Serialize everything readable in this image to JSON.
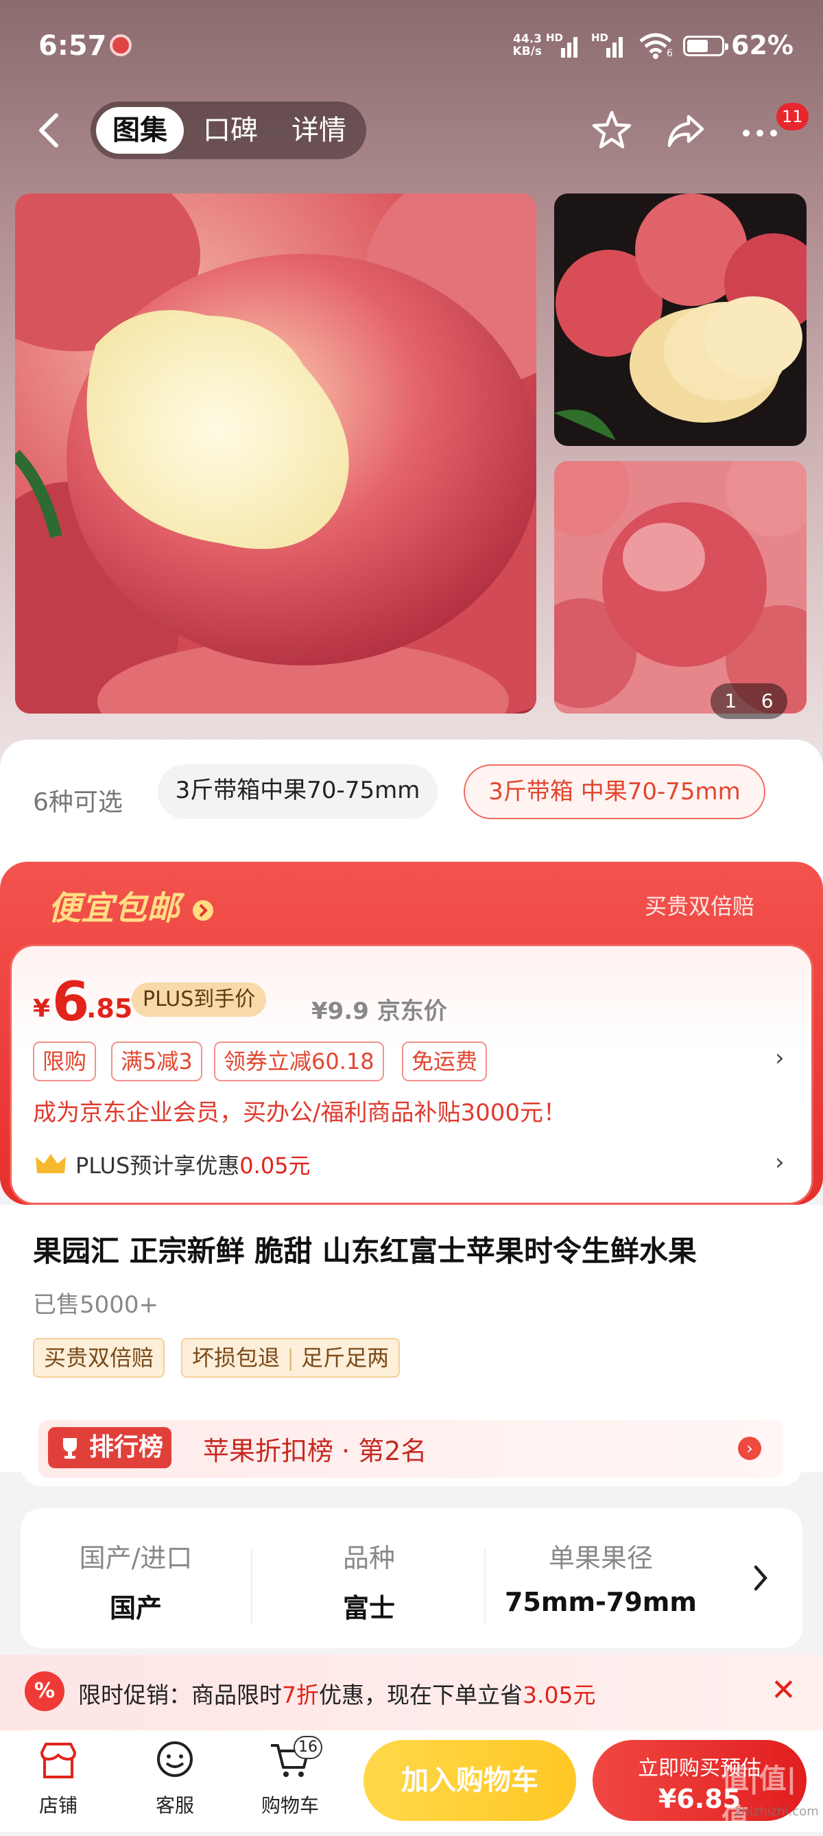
{
  "status": {
    "time": "6:57",
    "net_speed": "44.3",
    "net_unit": "KB/s",
    "net1": "HD",
    "net2": "HD",
    "wifi_sub": "6",
    "battery": "62%",
    "battery_level": 0.62
  },
  "nav": {
    "tabs": [
      "图集",
      "口碑",
      "详情"
    ],
    "active_tab": 0,
    "badge": "11",
    "icons": [
      "back-icon",
      "star-icon",
      "share-icon",
      "more-icon"
    ]
  },
  "gallery": {
    "counter_current": "1",
    "counter_total": "6"
  },
  "spec": {
    "count_label": "6种可选",
    "options": [
      "3斤带箱中果70-75mm",
      "3斤带箱 中果70-75mm"
    ],
    "selected_index": 1
  },
  "promo": {
    "title": "便宜包邮",
    "right": "买贵双倍赔",
    "price_currency": "¥",
    "price_int": "6",
    "price_dec": ".85",
    "plus_tag": "PLUS到手价",
    "jd_price": "¥9.9  京东价",
    "tags": [
      "限购",
      "满5减3",
      "领券立减60.18",
      "免运费"
    ],
    "corp_line": "成为京东企业会员，买办公/福利商品补贴3000元！",
    "plus_line_prefix": "PLUS预计享优惠",
    "plus_line_amount": "0.05元"
  },
  "product": {
    "title": "果园汇 正宗新鲜 脆甜 山东红富士苹果时令生鲜水果",
    "sold": "已售5000+",
    "service_tags": [
      "买贵双倍赔",
      "坏损包退",
      "足斤足两"
    ]
  },
  "rank": {
    "badge": "排行榜",
    "text": "苹果折扣榜 · 第2名"
  },
  "attributes": [
    {
      "key": "国产/进口",
      "value": "国产"
    },
    {
      "key": "品种",
      "value": "富士"
    },
    {
      "key": "单果果径",
      "value": "75mm-79mm"
    }
  ],
  "limit_promo": {
    "prefix": "限时促销：商品限时",
    "discount": "7折",
    "middle": "优惠，现在下单立省",
    "save": "3.05元"
  },
  "bottom": {
    "items": [
      {
        "label": "店铺",
        "icon": "shop-icon"
      },
      {
        "label": "客服",
        "icon": "service-icon"
      },
      {
        "label": "购物车",
        "icon": "cart-icon"
      }
    ],
    "cart_badge": "16",
    "add_cart": "加入购物车",
    "buy_line1": "立即购买预估",
    "buy_line2": "¥6.85"
  },
  "watermark": {
    "main": "值|值|值",
    "sub": "zhizhizhi.com"
  },
  "colors": {
    "accent_red": "#e2231a",
    "cart_yellow": "#ffc825",
    "plus_gold": "#f8d9a8"
  }
}
